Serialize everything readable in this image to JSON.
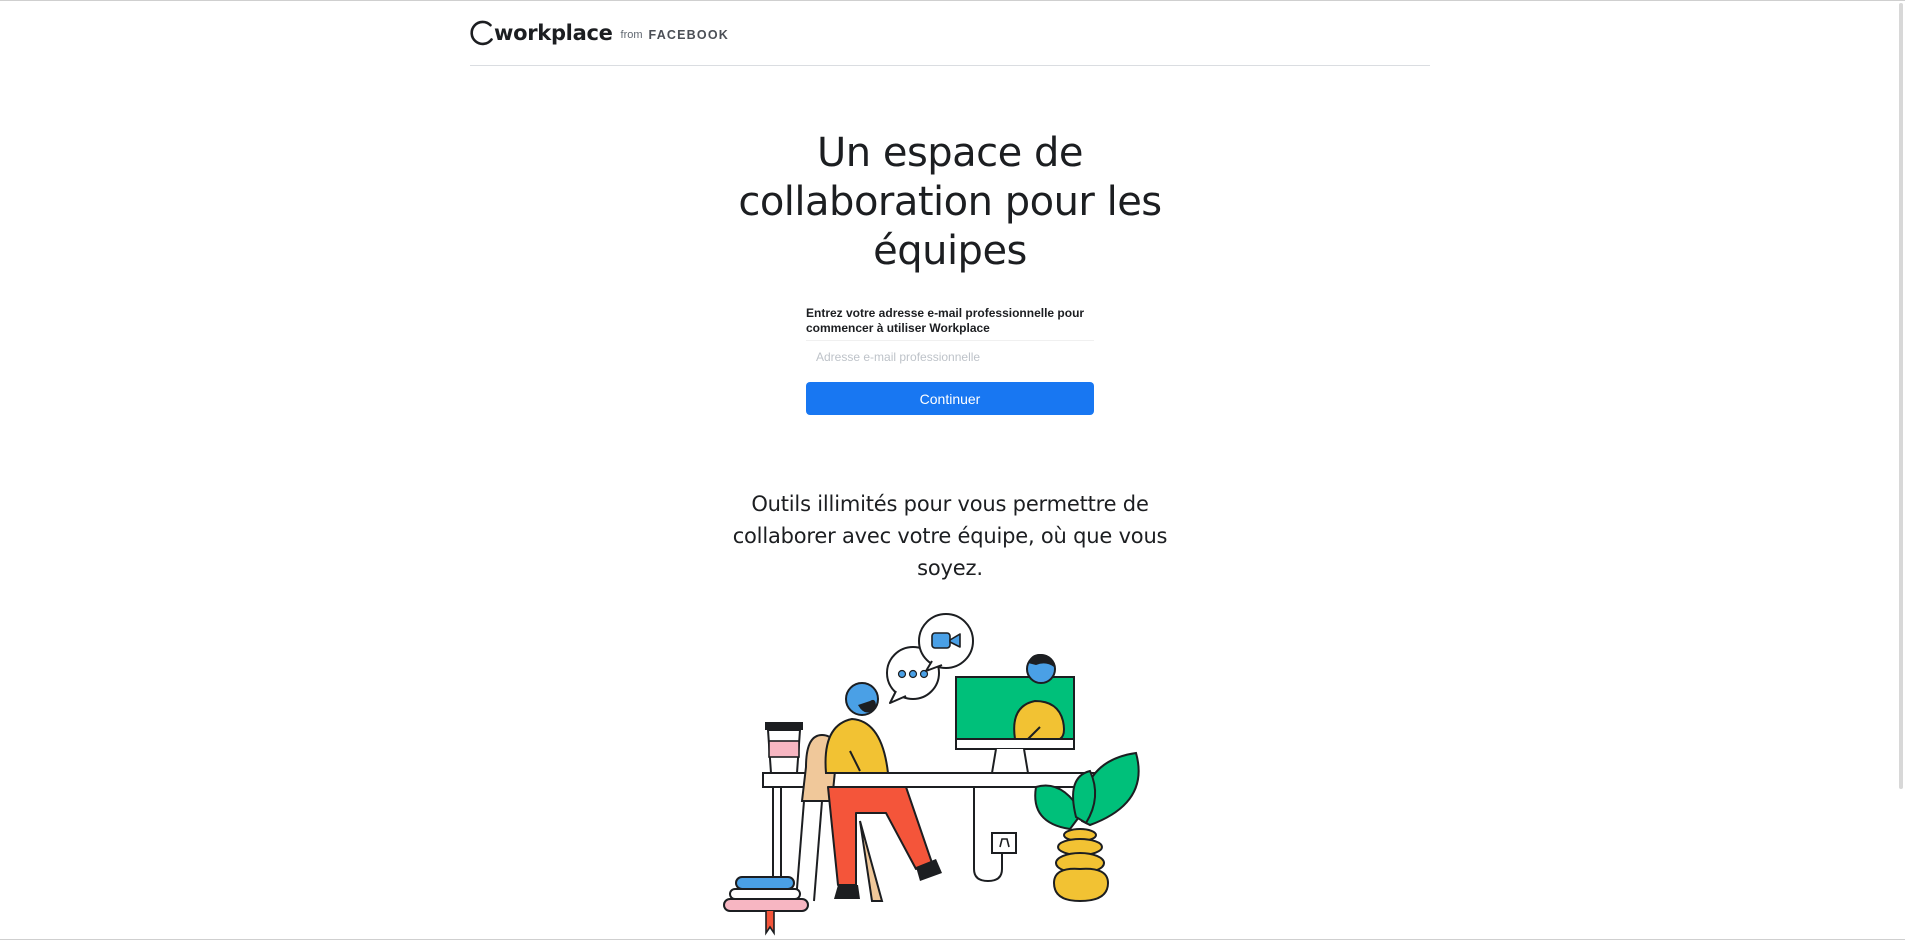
{
  "header": {
    "brand_word": "workplace",
    "brand_from": "from",
    "brand_company": "FACEBOOK"
  },
  "hero": {
    "title_line1": "Un espace de",
    "title_line2": "collaboration pour les",
    "title_line3": "équipes"
  },
  "signup_form": {
    "label": "Entrez votre adresse e-mail professionnelle pour commencer à utiliser Workplace",
    "email_value": "",
    "email_placeholder": "Adresse e-mail professionnelle",
    "submit_label": "Continuer"
  },
  "features": {
    "line1": "Outils illimités pour vous permettre de",
    "line2": "collaborer avec votre équipe, où que vous",
    "line3": "soyez."
  },
  "icons": {
    "logo": "workplace-logo-icon",
    "illustration": "team-collaboration-illustration"
  },
  "colors": {
    "primary_button": "#1877f2",
    "text": "#1c1e21",
    "illustration_green": "#00c07a",
    "illustration_yellow": "#f2c233",
    "illustration_blue": "#4aa0e6",
    "illustration_red": "#f4553a",
    "illustration_pink": "#f7b6c2"
  }
}
